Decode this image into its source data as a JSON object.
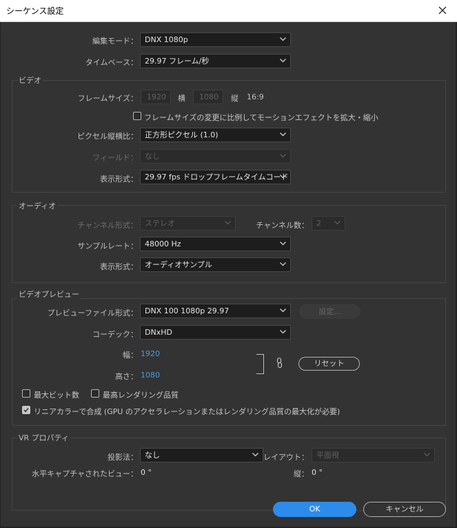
{
  "window": {
    "title": "シーケンス設定"
  },
  "general": {
    "edit_mode_label": "編集モード：",
    "edit_mode_value": "DNX 1080p",
    "timebase_label": "タイムベース：",
    "timebase_value": "29.97  フレーム/秒"
  },
  "video": {
    "section_title": "ビデオ",
    "frame_size_label": "フレームサイズ：",
    "frame_width": "1920",
    "width_label": "横",
    "frame_height": "1080",
    "height_label": "縦",
    "aspect": "16:9",
    "scale_checkbox_label": "フレームサイズの変更に比例してモーションエフェクトを拡大・縮小",
    "scale_checked": false,
    "pixel_aspect_label": "ピクセル縦横比：",
    "pixel_aspect_value": "正方形ピクセル (1.0)",
    "field_label": "フィールド：",
    "field_value": "なし",
    "display_format_label": "表示形式：",
    "display_format_value": "29.97  fps ドロップフレームタイムコード"
  },
  "audio": {
    "section_title": "オーディオ",
    "channel_format_label": "チャンネル形式：",
    "channel_format_value": "ステレオ",
    "channel_count_label": "チャンネル数：",
    "channel_count_value": "2",
    "sample_rate_label": "サンプルレート：",
    "sample_rate_value": "48000 Hz",
    "display_format_label": "表示形式：",
    "display_format_value": "オーディオサンプル"
  },
  "preview": {
    "section_title": "ビデオプレビュー",
    "preview_format_label": "プレビューファイル形式：",
    "preview_format_value": "DNX 100 1080p 29.97",
    "settings_button": "設定...",
    "codec_label": "コーデック：",
    "codec_value": "DNxHD",
    "width_label": "幅：",
    "width_value": "1920",
    "height_label": "高さ：",
    "height_value": "1080",
    "reset_button": "リセット",
    "max_bit_depth_label": "最大ビット数",
    "max_bit_depth_checked": false,
    "max_render_quality_label": "最高レンダリング品質",
    "max_render_quality_checked": false,
    "linear_color_label": "リニアカラーで合成 (GPU のアクセラレーションまたはレンダリング品質の最大化が必要)",
    "linear_color_checked": true
  },
  "vr": {
    "section_title": "VR プロパティ",
    "projection_label": "投影法：",
    "projection_value": "なし",
    "layout_label": "レイアウト：",
    "layout_value": "平面視",
    "h_capture_label": "水平キャプチャされたビュー：",
    "h_capture_value": "0 °",
    "v_label": "縦：",
    "v_value": "0 °"
  },
  "footer": {
    "ok_button": "OK",
    "cancel_button": "キャンセル"
  },
  "colors": {
    "accent": "#2d8ceb",
    "value_blue": "#4a9bde",
    "panel_bg": "#333333"
  }
}
